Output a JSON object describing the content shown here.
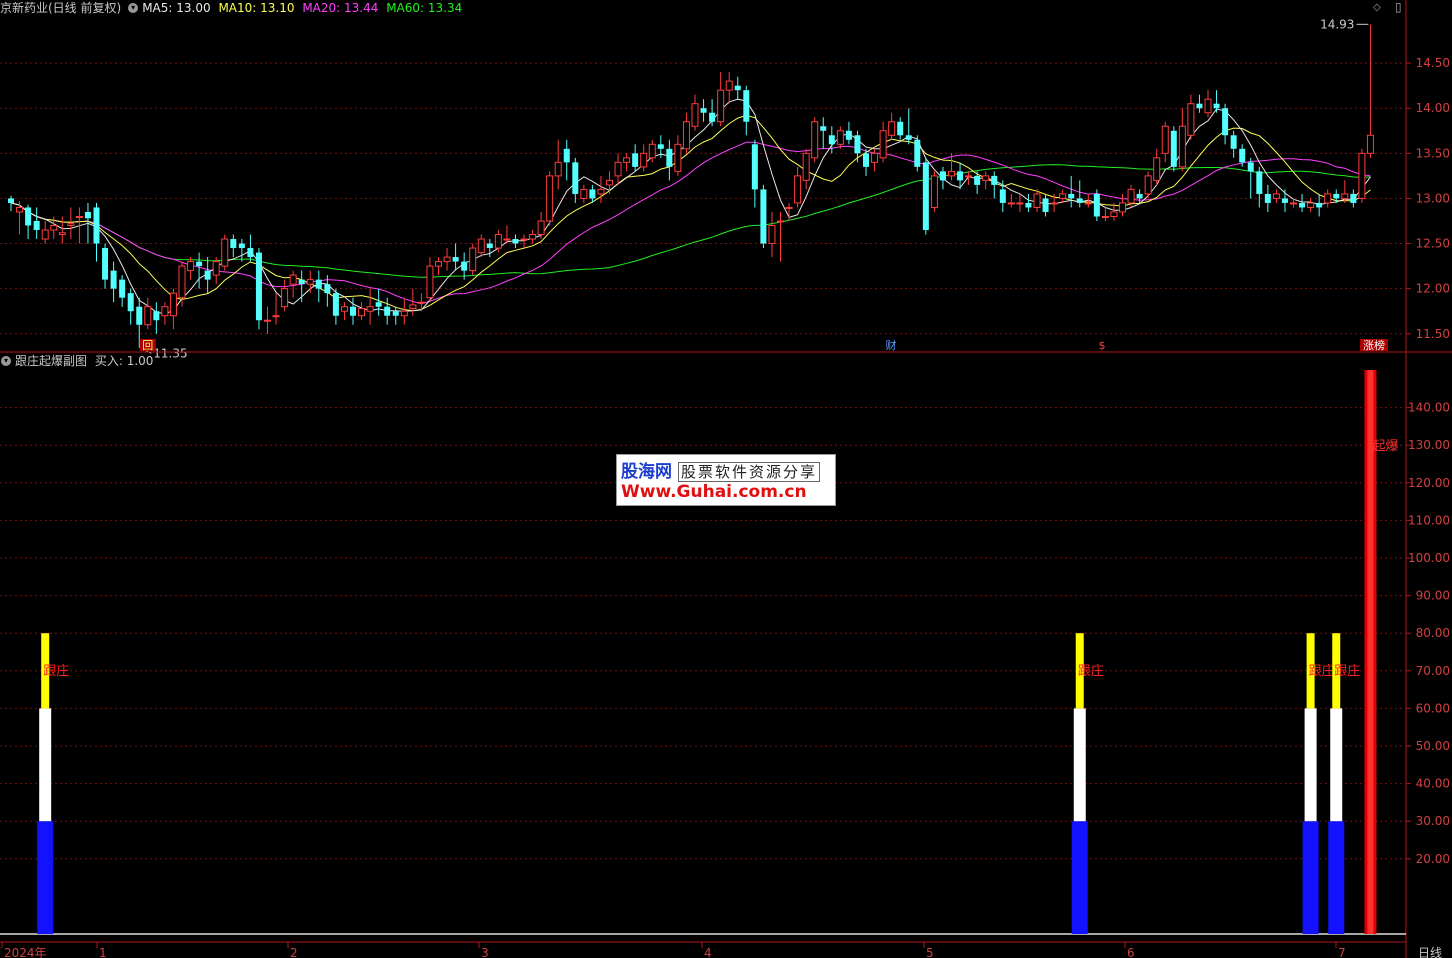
{
  "header": {
    "stock_title": "京新药业(日线 前复权)",
    "ma5": "MA5: 13.00",
    "ma10": "MA10: 13.10",
    "ma20": "MA20: 13.44",
    "ma60": "MA60: 13.34",
    "collapse_icon": "chevron-circle-icon"
  },
  "sub_header": {
    "indicator_title": "跟庄起爆副图",
    "buy_value": "买入: 1.00"
  },
  "watermark": {
    "brand": "股海网",
    "slogan": "股票软件资源分享",
    "url": "Www.Guhai.com.cn"
  },
  "annotations": {
    "high_label": "14.93",
    "low_label": "11.35",
    "event_hui": "回",
    "event_cai": "财",
    "event_s": "$",
    "event_zhangbang": "涨榜",
    "signal_label": "跟庄",
    "burst_label": "起爆"
  },
  "footer": {
    "period_label": "日线",
    "x_labels": [
      "2024年",
      "1",
      "2",
      "3",
      "4",
      "5",
      "6",
      "7"
    ]
  },
  "colors": {
    "up": "#ff3c3c",
    "down": "#54ffff",
    "ma5": "#e8e8e8",
    "ma10": "#ffff55",
    "ma20": "#ff40ff",
    "ma60": "#22ee22",
    "grid": "#7a1010",
    "axis": "#b01818"
  },
  "chart_data": [
    {
      "type": "candlestick",
      "title": "京新药业(日线 前复权)",
      "y_ticks": [
        11.5,
        12.0,
        12.5,
        13.0,
        13.5,
        14.0,
        14.5
      ],
      "ylim": [
        11.32,
        15.0
      ],
      "candles": [
        [
          13.0,
          12.95,
          12.86,
          13.03
        ],
        [
          12.85,
          12.9,
          12.6,
          12.97
        ],
        [
          12.9,
          12.7,
          12.55,
          12.93
        ],
        [
          12.75,
          12.65,
          12.55,
          12.9
        ],
        [
          12.55,
          12.65,
          12.5,
          12.75
        ],
        [
          12.65,
          12.7,
          12.55,
          12.8
        ],
        [
          12.6,
          12.62,
          12.5,
          12.8
        ],
        [
          12.7,
          12.72,
          12.55,
          12.9
        ],
        [
          12.8,
          12.8,
          12.5,
          12.9
        ],
        [
          12.85,
          12.78,
          12.5,
          12.95
        ],
        [
          12.9,
          12.5,
          12.3,
          12.95
        ],
        [
          12.45,
          12.1,
          12.0,
          12.5
        ],
        [
          12.2,
          12.0,
          11.85,
          12.3
        ],
        [
          12.1,
          11.9,
          11.8,
          12.15
        ],
        [
          11.95,
          11.75,
          11.6,
          12.0
        ],
        [
          11.8,
          11.6,
          11.35,
          11.9
        ],
        [
          11.6,
          11.8,
          11.55,
          11.9
        ],
        [
          11.75,
          11.65,
          11.5,
          11.85
        ],
        [
          11.7,
          11.8,
          11.6,
          11.85
        ],
        [
          11.7,
          11.95,
          11.55,
          12.0
        ],
        [
          11.9,
          12.25,
          11.8,
          12.3
        ],
        [
          12.2,
          12.3,
          12.1,
          12.35
        ],
        [
          12.3,
          12.25,
          12.0,
          12.4
        ],
        [
          12.2,
          12.1,
          11.95,
          12.35
        ],
        [
          12.15,
          12.3,
          12.05,
          12.35
        ],
        [
          12.25,
          12.55,
          12.2,
          12.6
        ],
        [
          12.55,
          12.45,
          12.35,
          12.6
        ],
        [
          12.5,
          12.45,
          12.3,
          12.55
        ],
        [
          12.45,
          12.35,
          12.3,
          12.6
        ],
        [
          12.4,
          11.65,
          11.55,
          12.45
        ],
        [
          11.65,
          11.65,
          11.5,
          11.8
        ],
        [
          11.7,
          11.7,
          11.6,
          11.95
        ],
        [
          11.8,
          12.0,
          11.75,
          12.1
        ],
        [
          12.05,
          12.15,
          11.9,
          12.2
        ],
        [
          12.1,
          12.05,
          11.85,
          12.2
        ],
        [
          12.05,
          12.1,
          11.95,
          12.2
        ],
        [
          12.1,
          12.0,
          11.85,
          12.2
        ],
        [
          12.05,
          11.95,
          11.8,
          12.15
        ],
        [
          11.95,
          11.7,
          11.6,
          12.0
        ],
        [
          11.75,
          11.8,
          11.65,
          11.85
        ],
        [
          11.8,
          11.7,
          11.6,
          11.9
        ],
        [
          11.7,
          11.78,
          11.65,
          11.85
        ],
        [
          11.75,
          11.8,
          11.6,
          12.0
        ],
        [
          11.85,
          11.8,
          11.7,
          12.0
        ],
        [
          11.8,
          11.7,
          11.6,
          11.9
        ],
        [
          11.75,
          11.7,
          11.6,
          11.8
        ],
        [
          11.7,
          11.75,
          11.6,
          11.9
        ],
        [
          11.78,
          11.82,
          11.7,
          12.0
        ],
        [
          11.85,
          11.85,
          11.75,
          11.95
        ],
        [
          11.9,
          12.25,
          11.85,
          12.35
        ],
        [
          12.25,
          12.3,
          12.15,
          12.35
        ],
        [
          12.3,
          12.35,
          12.2,
          12.45
        ],
        [
          12.35,
          12.3,
          12.2,
          12.5
        ],
        [
          12.3,
          12.2,
          12.1,
          12.4
        ],
        [
          12.2,
          12.45,
          12.15,
          12.5
        ],
        [
          12.4,
          12.55,
          12.35,
          12.6
        ],
        [
          12.5,
          12.45,
          12.35,
          12.55
        ],
        [
          12.45,
          12.6,
          12.4,
          12.65
        ],
        [
          12.55,
          12.55,
          12.5,
          12.7
        ],
        [
          12.55,
          12.5,
          12.45,
          12.6
        ],
        [
          12.55,
          12.55,
          12.45,
          12.6
        ],
        [
          12.55,
          12.6,
          12.5,
          12.65
        ],
        [
          12.6,
          12.75,
          12.55,
          12.85
        ],
        [
          12.75,
          13.25,
          12.7,
          13.3
        ],
        [
          13.25,
          13.4,
          13.1,
          13.65
        ],
        [
          13.55,
          13.4,
          13.2,
          13.65
        ],
        [
          13.4,
          13.05,
          12.95,
          13.45
        ],
        [
          13.0,
          13.1,
          12.95,
          13.15
        ],
        [
          13.1,
          13.0,
          12.95,
          13.15
        ],
        [
          13.05,
          13.1,
          12.95,
          13.25
        ],
        [
          13.15,
          13.2,
          13.05,
          13.3
        ],
        [
          13.25,
          13.4,
          13.15,
          13.5
        ],
        [
          13.4,
          13.45,
          13.3,
          13.5
        ],
        [
          13.5,
          13.35,
          13.3,
          13.6
        ],
        [
          13.35,
          13.5,
          13.3,
          13.6
        ],
        [
          13.45,
          13.6,
          13.4,
          13.65
        ],
        [
          13.6,
          13.55,
          13.45,
          13.7
        ],
        [
          13.55,
          13.35,
          13.2,
          13.65
        ],
        [
          13.3,
          13.6,
          13.25,
          13.7
        ],
        [
          13.55,
          13.85,
          13.5,
          13.95
        ],
        [
          13.8,
          14.05,
          13.75,
          14.15
        ],
        [
          14.0,
          13.95,
          13.85,
          14.1
        ],
        [
          13.95,
          13.85,
          13.8,
          14.1
        ],
        [
          13.85,
          14.2,
          13.8,
          14.4
        ],
        [
          14.2,
          14.3,
          14.05,
          14.4
        ],
        [
          14.25,
          14.2,
          14.1,
          14.35
        ],
        [
          14.2,
          13.85,
          13.7,
          14.25
        ],
        [
          13.6,
          13.1,
          12.9,
          13.65
        ],
        [
          13.1,
          12.5,
          12.45,
          13.15
        ],
        [
          12.5,
          12.7,
          12.35,
          12.85
        ],
        [
          12.75,
          12.75,
          12.3,
          12.85
        ],
        [
          12.9,
          12.9,
          12.75,
          12.95
        ],
        [
          12.95,
          13.25,
          12.9,
          13.35
        ],
        [
          13.2,
          13.5,
          13.1,
          13.55
        ],
        [
          13.45,
          13.85,
          13.4,
          13.9
        ],
        [
          13.8,
          13.75,
          13.55,
          13.9
        ],
        [
          13.7,
          13.6,
          13.5,
          13.8
        ],
        [
          13.6,
          13.75,
          13.55,
          13.8
        ],
        [
          13.75,
          13.65,
          13.6,
          13.85
        ],
        [
          13.7,
          13.5,
          13.4,
          13.75
        ],
        [
          13.5,
          13.35,
          13.25,
          13.55
        ],
        [
          13.4,
          13.5,
          13.3,
          13.55
        ],
        [
          13.45,
          13.75,
          13.4,
          13.85
        ],
        [
          13.7,
          13.85,
          13.65,
          13.95
        ],
        [
          13.85,
          13.7,
          13.65,
          13.9
        ],
        [
          13.7,
          13.65,
          13.6,
          14.0
        ],
        [
          13.65,
          13.35,
          13.3,
          13.7
        ],
        [
          13.4,
          12.65,
          12.6,
          13.45
        ],
        [
          12.9,
          13.25,
          12.85,
          13.3
        ],
        [
          13.3,
          13.2,
          13.1,
          13.35
        ],
        [
          13.25,
          13.3,
          13.2,
          13.5
        ],
        [
          13.3,
          13.2,
          13.1,
          13.4
        ],
        [
          13.25,
          13.25,
          13.15,
          13.3
        ],
        [
          13.25,
          13.15,
          13.05,
          13.3
        ],
        [
          13.2,
          13.25,
          13.1,
          13.3
        ],
        [
          13.25,
          13.15,
          13.0,
          13.3
        ],
        [
          13.1,
          12.95,
          12.85,
          13.2
        ],
        [
          12.95,
          12.95,
          12.9,
          13.05
        ],
        [
          12.95,
          12.95,
          12.85,
          13.05
        ],
        [
          12.95,
          12.9,
          12.85,
          13.05
        ],
        [
          12.9,
          13.05,
          12.85,
          13.1
        ],
        [
          13.0,
          12.85,
          12.8,
          13.05
        ],
        [
          12.95,
          12.95,
          12.85,
          13.05
        ],
        [
          13.0,
          13.05,
          12.95,
          13.1
        ],
        [
          13.05,
          13.0,
          12.9,
          13.25
        ],
        [
          13.0,
          12.95,
          12.9,
          13.2
        ],
        [
          12.95,
          12.95,
          12.9,
          13.05
        ],
        [
          13.05,
          12.8,
          12.75,
          13.1
        ],
        [
          12.8,
          12.8,
          12.75,
          12.9
        ],
        [
          12.8,
          12.85,
          12.75,
          12.95
        ],
        [
          12.85,
          12.95,
          12.8,
          13.05
        ],
        [
          12.95,
          13.1,
          12.9,
          13.15
        ],
        [
          13.05,
          13.0,
          12.95,
          13.1
        ],
        [
          13.05,
          13.25,
          13.0,
          13.3
        ],
        [
          13.2,
          13.45,
          13.15,
          13.55
        ],
        [
          13.5,
          13.8,
          13.4,
          13.85
        ],
        [
          13.75,
          13.35,
          13.3,
          13.8
        ],
        [
          13.35,
          13.8,
          13.3,
          14.0
        ],
        [
          13.7,
          14.05,
          13.65,
          14.15
        ],
        [
          14.05,
          14.0,
          13.95,
          14.15
        ],
        [
          13.95,
          14.1,
          13.9,
          14.2
        ],
        [
          14.05,
          14.0,
          13.95,
          14.2
        ],
        [
          14.0,
          13.7,
          13.6,
          14.05
        ],
        [
          13.7,
          13.55,
          13.45,
          13.75
        ],
        [
          13.55,
          13.4,
          13.35,
          13.6
        ],
        [
          13.4,
          13.3,
          13.0,
          13.45
        ],
        [
          13.3,
          13.05,
          12.9,
          13.35
        ],
        [
          13.05,
          12.95,
          12.85,
          13.15
        ],
        [
          13.0,
          13.05,
          12.95,
          13.1
        ],
        [
          13.0,
          12.95,
          12.85,
          13.1
        ],
        [
          12.95,
          12.95,
          12.9,
          13.0
        ],
        [
          12.95,
          12.9,
          12.85,
          13.05
        ],
        [
          12.9,
          12.95,
          12.85,
          13.0
        ],
        [
          12.95,
          12.9,
          12.8,
          13.05
        ],
        [
          12.95,
          13.05,
          12.9,
          13.1
        ],
        [
          13.05,
          13.0,
          12.95,
          13.1
        ],
        [
          13.0,
          13.05,
          12.95,
          13.2
        ],
        [
          13.05,
          12.95,
          12.9,
          13.1
        ],
        [
          13.0,
          13.5,
          12.95,
          13.55
        ],
        [
          13.5,
          13.7,
          13.45,
          14.93
        ]
      ]
    },
    {
      "type": "bar",
      "title": "跟庄起爆副图",
      "y_ticks": [
        20,
        30,
        40,
        50,
        60,
        70,
        80,
        90,
        100,
        110,
        120,
        130,
        140
      ],
      "ylim": [
        0,
        150
      ],
      "signals": [
        {
          "bar": 4,
          "label": "跟庄"
        },
        {
          "bar": 125,
          "label": "跟庄"
        },
        {
          "bar": 152,
          "label": "跟庄"
        },
        {
          "bar": 155,
          "label": "跟庄"
        }
      ],
      "signal_levels": {
        "blue": 30,
        "white": 60,
        "yellow": 80
      },
      "burst": {
        "bar": 159,
        "value": 150,
        "label": "起爆"
      }
    }
  ]
}
